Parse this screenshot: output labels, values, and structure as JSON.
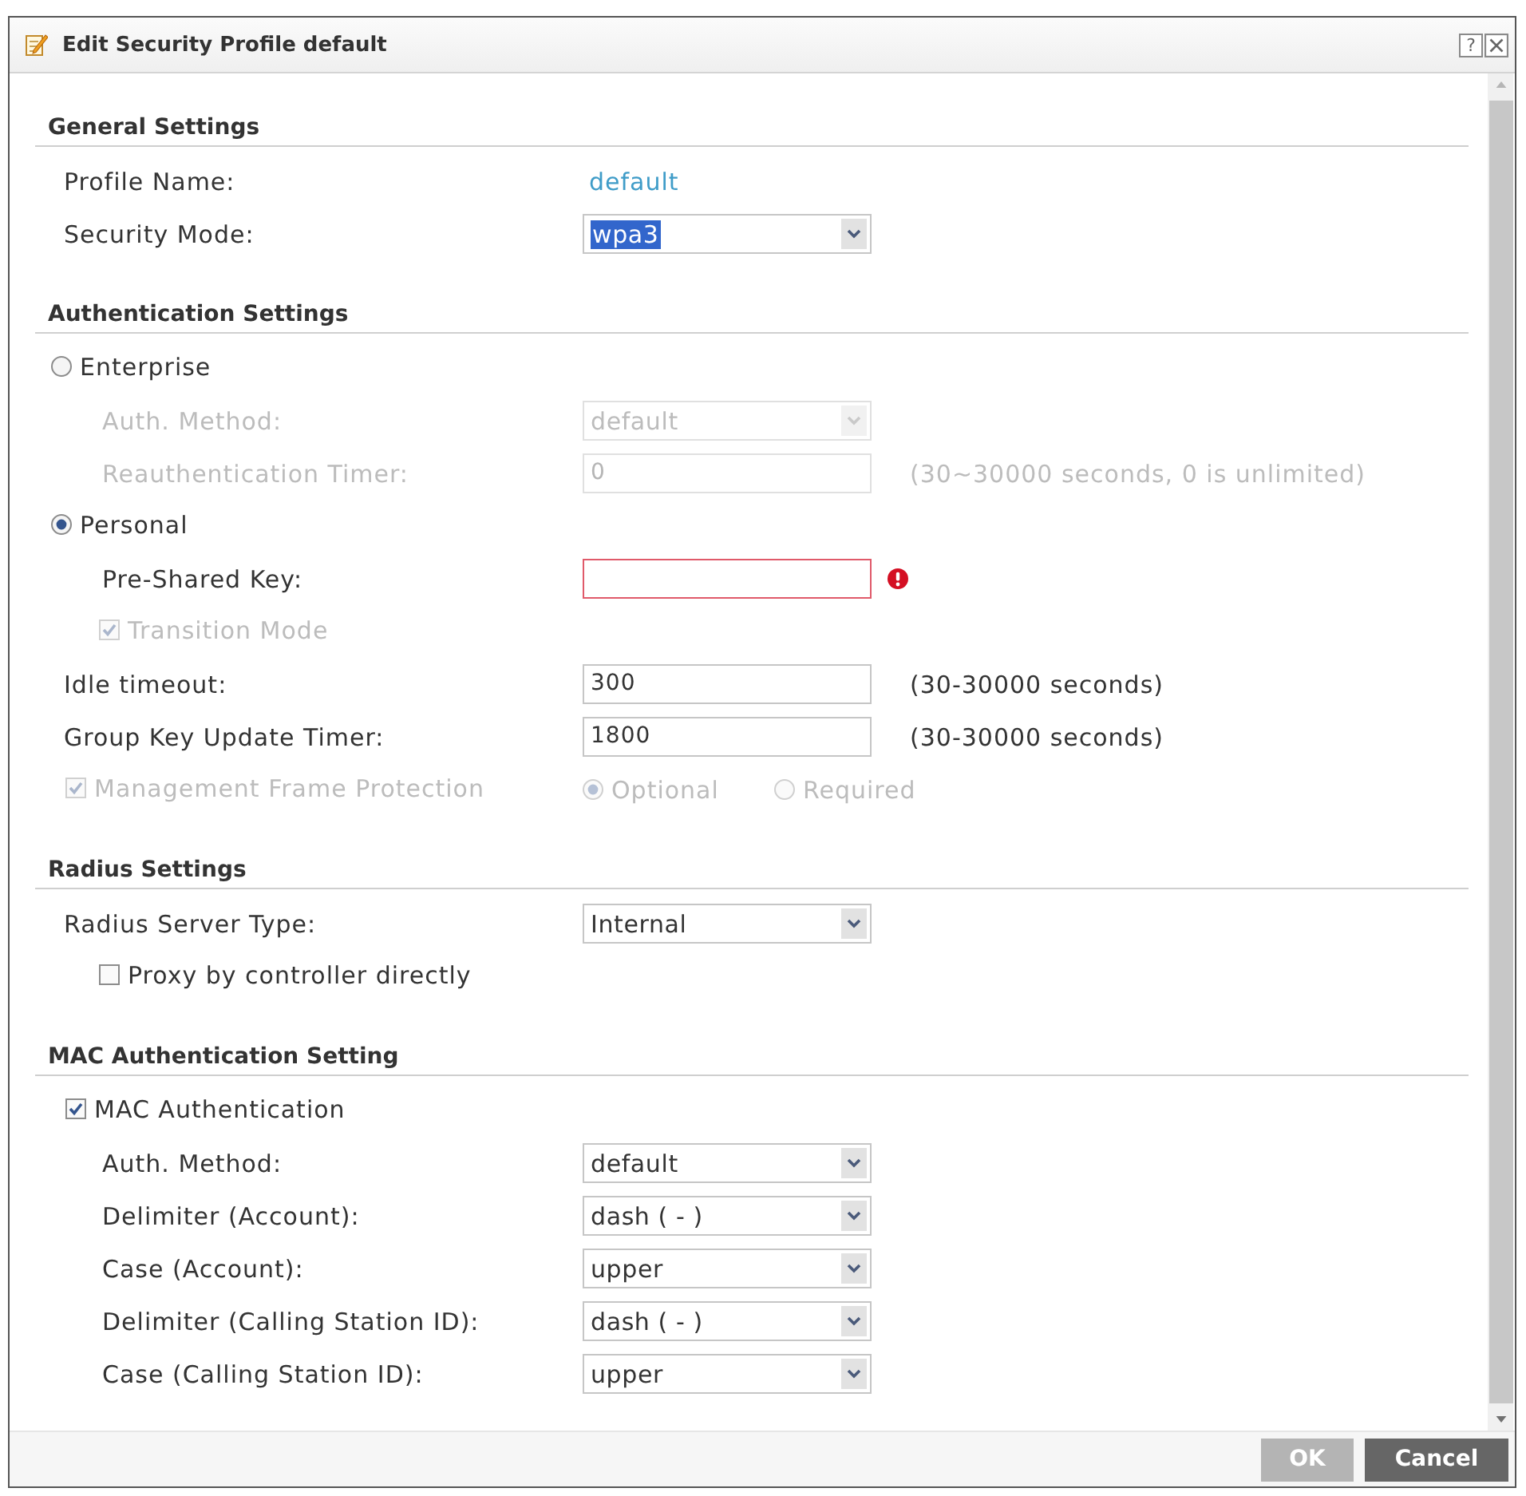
{
  "dialog": {
    "title": "Edit Security Profile default",
    "help_button": "?"
  },
  "sections": [
    {
      "title": "General Settings",
      "rows": [
        {
          "kind": "text",
          "label": "Profile Name:",
          "value": "default",
          "disabled": false
        },
        {
          "kind": "select",
          "label": "Security Mode:",
          "value": "wpa3",
          "highlighted": true,
          "disabled": false
        }
      ]
    },
    {
      "title": "Authentication Settings",
      "rows": [
        {
          "kind": "radio",
          "label": "Enterprise",
          "selected": false,
          "disabled": false,
          "children": [
            {
              "kind": "select",
              "label": "Auth. Method:",
              "value": "default",
              "highlighted": false,
              "disabled": true
            },
            {
              "kind": "input",
              "label": "Reauthentication Timer:",
              "value": "0",
              "hint": "(30~30000 seconds, 0 is unlimited)",
              "error": false,
              "disabled": true
            }
          ]
        },
        {
          "kind": "radio",
          "label": "Personal",
          "selected": true,
          "disabled": false,
          "children": [
            {
              "kind": "input",
              "label": "Pre-Shared Key:",
              "error": true,
              "disabled": false
            },
            {
              "kind": "checkbox",
              "label": "Transition Mode",
              "checked": true,
              "disabled": true
            }
          ]
        },
        {
          "kind": "input",
          "label": "Idle timeout:",
          "value": "300",
          "hint": "(30-30000 seconds)",
          "error": false,
          "disabled": false
        },
        {
          "kind": "input",
          "label": "Group Key Update Timer:",
          "value": "1800",
          "hint": "(30-30000 seconds)",
          "error": false,
          "disabled": false
        },
        {
          "kind": "checkbox",
          "label": "Management Frame Protection",
          "checked": true,
          "disabled": true,
          "options": [
            {
              "label": "Optional",
              "selected": true
            },
            {
              "label": "Required",
              "selected": false
            }
          ]
        }
      ]
    },
    {
      "title": "Radius Settings",
      "rows": [
        {
          "kind": "select",
          "label": "Radius Server Type:",
          "value": "Internal",
          "highlighted": false,
          "disabled": false,
          "children": [
            {
              "kind": "checkbox",
              "label": "Proxy by controller directly",
              "checked": false,
              "disabled": false
            }
          ]
        }
      ]
    },
    {
      "title": "MAC Authentication Setting",
      "rows": [
        {
          "kind": "checkbox",
          "label": "MAC Authentication",
          "checked": true,
          "disabled": false,
          "children": [
            {
              "kind": "select",
              "label": "Auth. Method:",
              "value": "default",
              "highlighted": false,
              "disabled": false
            },
            {
              "kind": "select",
              "label": "Delimiter (Account):",
              "value": "dash ( - )",
              "highlighted": false,
              "disabled": false
            },
            {
              "kind": "select",
              "label": "Case (Account):",
              "value": "upper",
              "highlighted": false,
              "disabled": false
            },
            {
              "kind": "select",
              "label": "Delimiter (Calling Station ID):",
              "value": "dash ( - )",
              "highlighted": false,
              "disabled": false
            },
            {
              "kind": "select",
              "label": "Case (Calling Station ID):",
              "value": "upper",
              "highlighted": false,
              "disabled": false
            }
          ]
        }
      ]
    }
  ],
  "buttons": [
    {
      "label": "OK",
      "disabled": true
    },
    {
      "label": "Cancel",
      "disabled": false
    }
  ]
}
